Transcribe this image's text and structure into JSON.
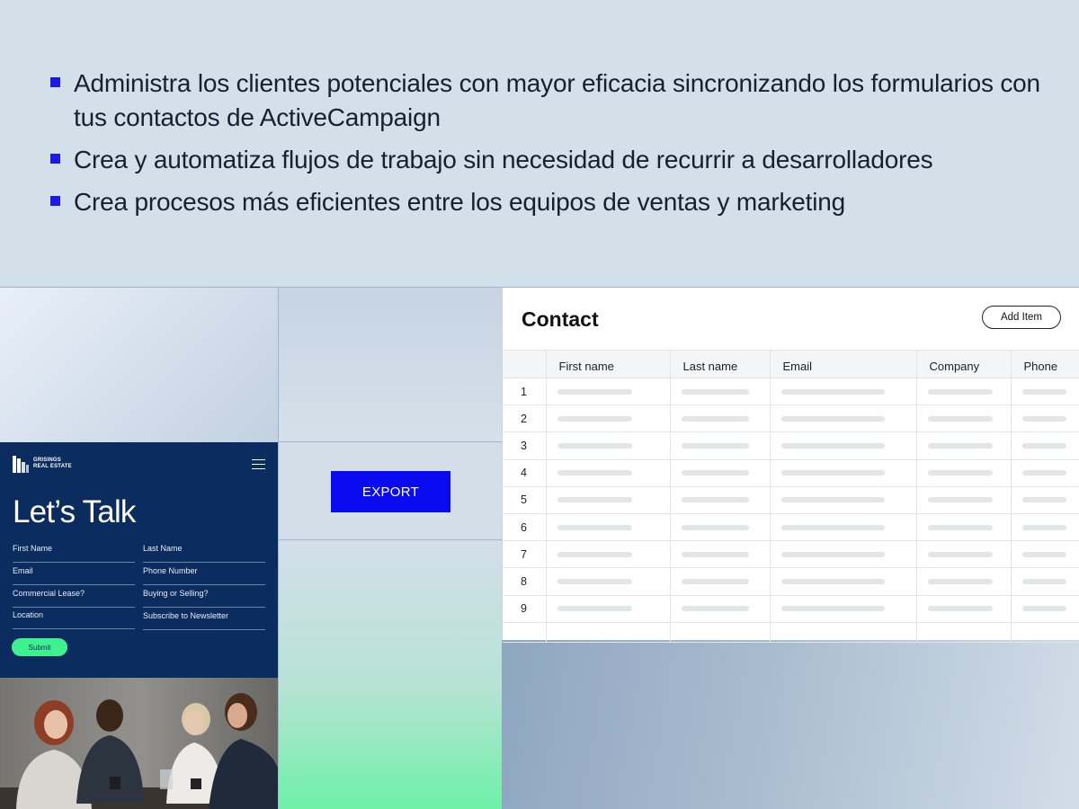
{
  "bullets": [
    "Administra los clientes potenciales con mayor eficacia sincronizando los formularios con tus contactos de ActiveCampaign",
    "Crea y automatiza flujos de trabajo sin necesidad de recurrir a desarrolladores",
    "Crea procesos más eficientes entre los equipos de ventas y marketing"
  ],
  "export": {
    "label": "EXPORT"
  },
  "form": {
    "logo_line1": "GRISINGS",
    "logo_line2": "REAL ESTATE",
    "title": "Let’s Talk",
    "fields": {
      "first_name": "First Name",
      "last_name": "Last Name",
      "email": "Email",
      "phone": "Phone Number",
      "commercial": "Commercial Lease?",
      "buying": "Buying or Selling?",
      "location": "Location",
      "newsletter": "Subscribe to Newsletter"
    },
    "submit": "Submit"
  },
  "contact": {
    "title": "Contact",
    "add_item": "Add Item",
    "columns": [
      "",
      "First name",
      "Last name",
      "Email",
      "Company",
      "Phone"
    ],
    "rows": [
      "1",
      "2",
      "3",
      "4",
      "5",
      "6",
      "7",
      "8",
      "9"
    ]
  },
  "colors": {
    "accent_blue": "#0a0af0",
    "form_navy": "#0b2c5e",
    "submit_green": "#3ff08f",
    "bullet_blue": "#1b1be6"
  }
}
